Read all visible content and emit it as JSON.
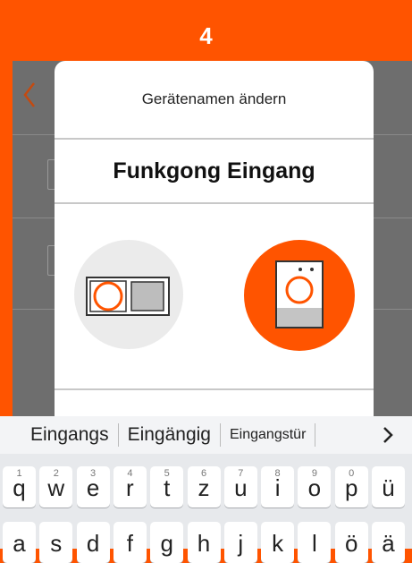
{
  "step": {
    "number": "4"
  },
  "dialog": {
    "title": "Gerätenamen ändern",
    "device_name": "Funkgong Eingang",
    "options": [
      {
        "icon": "chime-device-icon",
        "selected": false
      },
      {
        "icon": "doorbell-device-icon",
        "selected": true
      }
    ]
  },
  "keyboard": {
    "suggestions": [
      "Eingangs",
      "Eingängig",
      "Eingangstür"
    ],
    "row1": [
      {
        "key": "q",
        "hint": "1"
      },
      {
        "key": "w",
        "hint": "2"
      },
      {
        "key": "e",
        "hint": "3"
      },
      {
        "key": "r",
        "hint": "4"
      },
      {
        "key": "t",
        "hint": "5"
      },
      {
        "key": "z",
        "hint": "6"
      },
      {
        "key": "u",
        "hint": "7"
      },
      {
        "key": "i",
        "hint": "8"
      },
      {
        "key": "o",
        "hint": "9"
      },
      {
        "key": "p",
        "hint": "0"
      },
      {
        "key": "ü",
        "hint": ""
      }
    ],
    "row2": [
      "a",
      "s",
      "d",
      "f",
      "g",
      "h",
      "j",
      "k",
      "l",
      "ö",
      "ä"
    ]
  },
  "colors": {
    "accent": "#ff5400",
    "overlay": "#6e6e6e",
    "keyboard_bg": "#e7e9ec"
  }
}
